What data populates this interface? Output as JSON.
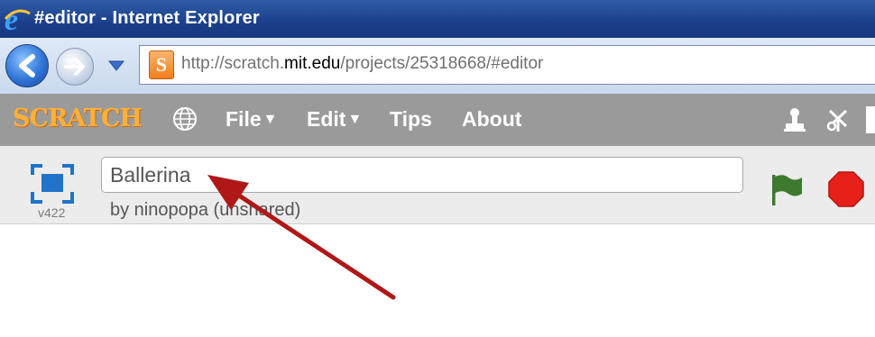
{
  "window": {
    "title": "#editor - Internet Explorer"
  },
  "browser": {
    "url_prefix": "http://scratch.",
    "url_host": "mit.edu",
    "url_path": "/projects/25318668/#editor",
    "favicon_letter": "S"
  },
  "menubar": {
    "logo": "SCRATCH",
    "items": [
      {
        "label": "File",
        "caret": "▼"
      },
      {
        "label": "Edit",
        "caret": "▼"
      },
      {
        "label": "Tips"
      },
      {
        "label": "About"
      }
    ]
  },
  "project": {
    "title_value": "Ballerina",
    "byline": "by ninopopa (unshared)",
    "version": "v422"
  },
  "colors": {
    "menubar": "#9a9a9a",
    "logo": "#ffb03b",
    "flag": "#3d7a2f",
    "stop": "#e8201a",
    "annotation_arrow": "#b01818"
  }
}
